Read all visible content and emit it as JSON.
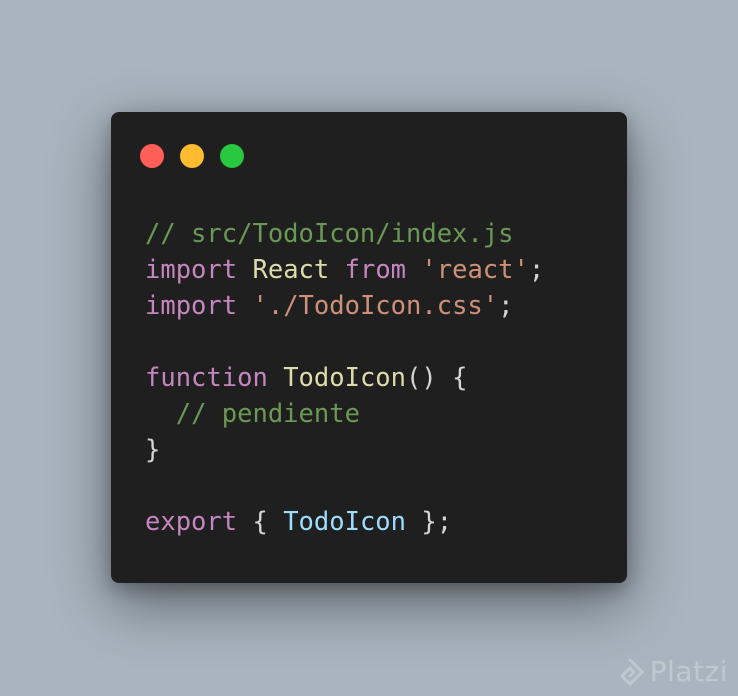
{
  "window": {
    "title_dots": [
      "close",
      "minimize",
      "maximize"
    ],
    "colors": {
      "background": "#1f1f1f",
      "dot_close": "#ff5f57",
      "dot_minimize": "#febc2e",
      "dot_maximize": "#28c840"
    }
  },
  "code": {
    "language": "javascript",
    "lines": [
      [
        {
          "t": "// src/TodoIcon/index.js",
          "k": "comment"
        }
      ],
      [
        {
          "t": "import",
          "k": "keyword"
        },
        {
          "t": " ",
          "k": "plain"
        },
        {
          "t": "React",
          "k": "ident"
        },
        {
          "t": " ",
          "k": "plain"
        },
        {
          "t": "from",
          "k": "keyword"
        },
        {
          "t": " ",
          "k": "plain"
        },
        {
          "t": "'react'",
          "k": "string"
        },
        {
          "t": ";",
          "k": "plain"
        }
      ],
      [
        {
          "t": "import",
          "k": "keyword"
        },
        {
          "t": " ",
          "k": "plain"
        },
        {
          "t": "'./TodoIcon.css'",
          "k": "string"
        },
        {
          "t": ";",
          "k": "plain"
        }
      ],
      [],
      [
        {
          "t": "function",
          "k": "keyword"
        },
        {
          "t": " ",
          "k": "plain"
        },
        {
          "t": "TodoIcon",
          "k": "ident"
        },
        {
          "t": "() {",
          "k": "plain"
        }
      ],
      [
        {
          "t": "  ",
          "k": "plain"
        },
        {
          "t": "// pendiente",
          "k": "comment"
        }
      ],
      [
        {
          "t": "}",
          "k": "plain"
        }
      ],
      [],
      [
        {
          "t": "export",
          "k": "keyword"
        },
        {
          "t": " { ",
          "k": "plain"
        },
        {
          "t": "TodoIcon",
          "k": "var"
        },
        {
          "t": " };",
          "k": "plain"
        }
      ]
    ],
    "syntax_colors": {
      "comment": "#6a9955",
      "keyword": "#c586c0",
      "ident": "#dcdcaa",
      "plain": "#d4d4d4",
      "string": "#ce9178",
      "var": "#9cdcfe"
    }
  },
  "watermark": {
    "text": "Platzi",
    "icon": "platzi-logo-icon"
  }
}
